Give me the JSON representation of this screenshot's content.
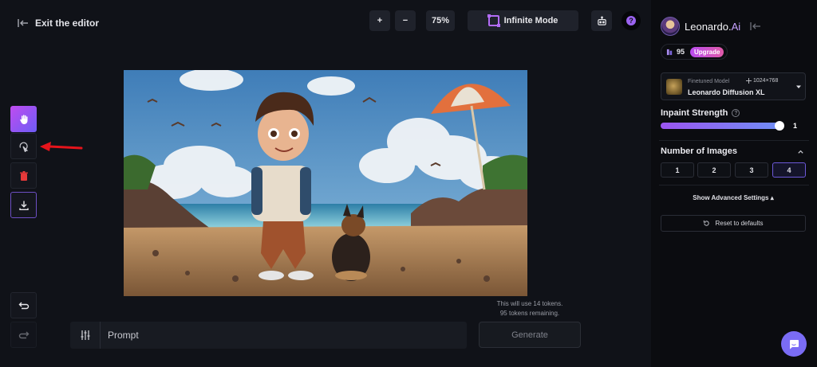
{
  "editor": {
    "exit_label": "Exit the editor"
  },
  "toolbar": {
    "zoom_in": "+",
    "zoom_out": "−",
    "zoom_level": "75%",
    "infinite_mode": "Infinite Mode",
    "help_glyph": "?"
  },
  "tools": [
    {
      "name": "hand-tool",
      "icon": "hand-icon"
    },
    {
      "name": "erase-tool",
      "icon": "eraser-icon"
    },
    {
      "name": "delete-tool",
      "icon": "trash-icon"
    },
    {
      "name": "download-tool",
      "icon": "download-icon"
    },
    {
      "name": "undo-tool",
      "icon": "undo-icon"
    },
    {
      "name": "redo-tool",
      "icon": "redo-icon"
    }
  ],
  "tokens": {
    "line1": "This will use 14 tokens.",
    "line2": "95 tokens remaining."
  },
  "prompt": {
    "placeholder": "Prompt"
  },
  "generate_label": "Generate",
  "panel": {
    "brand_name": "Leonardo.",
    "brand_suffix": "Ai",
    "credits": "95",
    "upgrade_label": "Upgrade",
    "model": {
      "kind": "Finetuned Model",
      "dims": "1024×768",
      "name": "Leonardo Diffusion XL"
    },
    "inpaint_label": "Inpaint Strength",
    "inpaint_value": "1",
    "info_glyph": "?",
    "num_images_label": "Number of Images",
    "num_images_options": [
      "1",
      "2",
      "3",
      "4"
    ],
    "num_images_selected": "4",
    "advanced_label": "Show Advanced Settings ▴",
    "reset_label": "Reset to defaults"
  },
  "colors": {
    "accent": "#9b55f0",
    "annotation_arrow": "#e5141b",
    "background": "#101218"
  }
}
